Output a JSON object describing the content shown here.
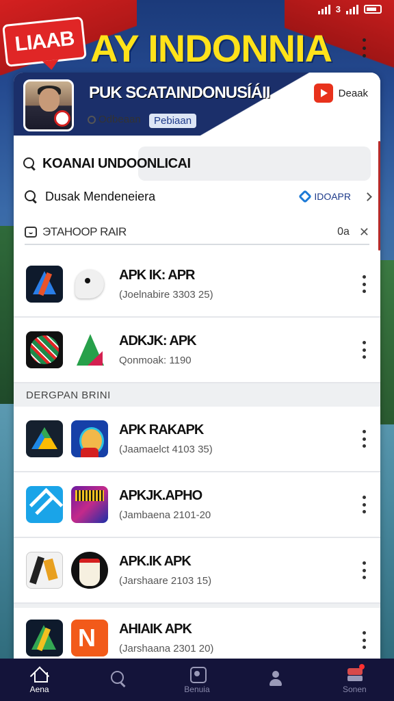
{
  "status_bar": {
    "signal_text": "3"
  },
  "banner": {
    "tag": "LIAAB",
    "title": "AY INDONNIA"
  },
  "header": {
    "title": "PUK SCATAINDONUSÍÁII",
    "chip_status": "Odbeaan",
    "chip_tag": "Pebiaan",
    "action_label": "Deaak"
  },
  "search": {
    "primary_text": "KOANAI UNDOONLICAI",
    "secondary_text": "Dusak Mendeneiera",
    "secondary_right": "IDOAPR"
  },
  "sort": {
    "label": "ЭТАНООР RAIR",
    "count": "0a"
  },
  "apps_top": [
    {
      "title": "APK IK: APR",
      "subtitle": "(Joelnabire 3303 25)"
    },
    {
      "title": "ADKJK: APK",
      "subtitle": "Qonmoak: 1190"
    }
  ],
  "section_label": "DERGPAN BRINI",
  "apps_bottom": [
    {
      "title": "APK RAKAPK",
      "subtitle": "(Jaamaelct 4103 35)"
    },
    {
      "title": "APKJK.APHO",
      "subtitle": "(Jambaena 2101-20"
    },
    {
      "title": "APK.IK APK",
      "subtitle": "(Jarshaare 2103 15)"
    },
    {
      "title": "AHIAIK APK",
      "subtitle": "(Jarshaana 2301 20)"
    }
  ],
  "bottom_nav": [
    {
      "label": "Aena",
      "icon": "home-icon"
    },
    {
      "label": "",
      "icon": "search-icon"
    },
    {
      "label": "Benuia",
      "icon": "camera-icon"
    },
    {
      "label": "",
      "icon": "user-icon"
    },
    {
      "label": "Sonen",
      "icon": "store-icon"
    }
  ],
  "colors": {
    "banner_red": "#d42020",
    "banner_yellow": "#ffe21a",
    "header_navy": "#1b2f6a",
    "nav_bg": "#14143a"
  }
}
